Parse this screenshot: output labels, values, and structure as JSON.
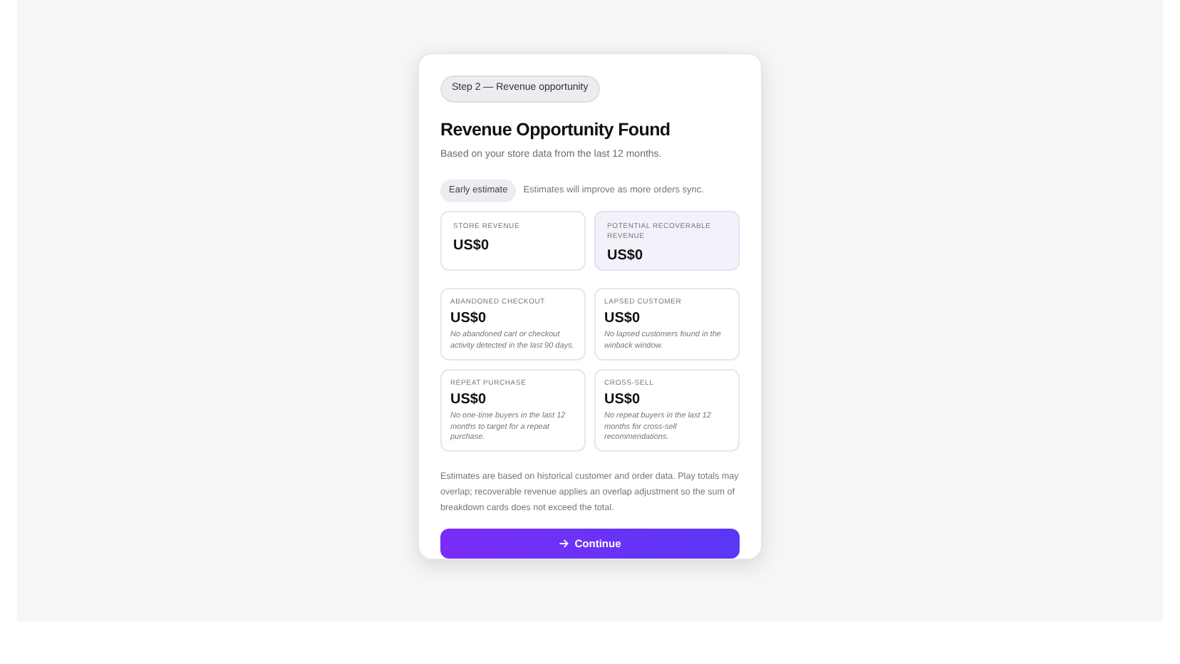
{
  "step_badge": "Step 2 — Revenue opportunity",
  "title": "Revenue Opportunity Found",
  "subtitle": "Based on your store data from the last 12 months.",
  "estimate_badge": "Early estimate",
  "estimate_note": "Estimates will improve as more orders sync.",
  "summary": [
    {
      "label": "STORE REVENUE",
      "value": "US$0",
      "highlighted": false
    },
    {
      "label": "POTENTIAL RECOVERABLE REVENUE",
      "value": "US$0",
      "highlighted": true
    }
  ],
  "breakdown": [
    {
      "label": "ABANDONED CHECKOUT",
      "value": "US$0",
      "note": "No abandoned cart or checkout activity detected in the last 90 days."
    },
    {
      "label": "LAPSED CUSTOMER",
      "value": "US$0",
      "note": "No lapsed customers found in the winback window."
    },
    {
      "label": "REPEAT PURCHASE",
      "value": "US$0",
      "note": "No one-time buyers in the last 12 months to target for a repeat purchase."
    },
    {
      "label": "CROSS-SELL",
      "value": "US$0",
      "note": "No repeat buyers in the last 12 months for cross-sell recommendations."
    }
  ],
  "disclaimer": "Estimates are based on historical customer and order data. Play totals may overlap; recoverable revenue applies an overlap adjustment so the sum of breakdown cards does not exceed the total.",
  "continue_button": "Continue"
}
